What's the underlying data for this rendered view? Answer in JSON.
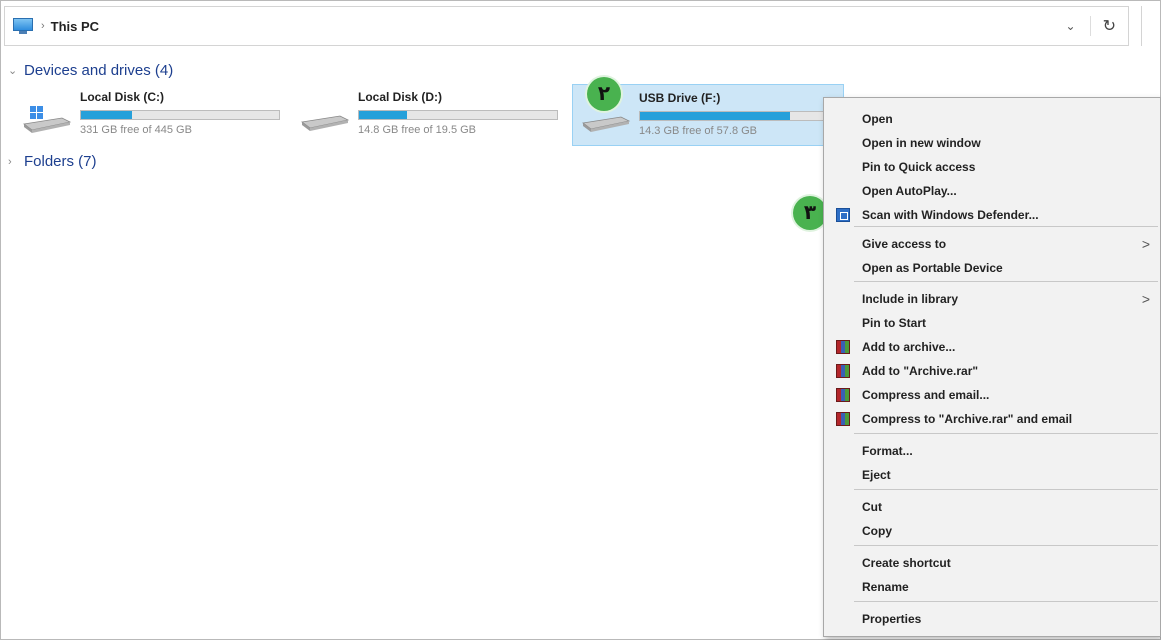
{
  "address": {
    "location": "This PC",
    "separator": "›",
    "dropdown": "⌄",
    "refresh": "↻"
  },
  "groups": {
    "devices": {
      "label": "Devices and drives (4)",
      "expanded": true
    },
    "folders": {
      "label": "Folders (7)",
      "expanded": false
    }
  },
  "drives": [
    {
      "name": "Local Disk (C:)",
      "free": "331 GB free of 445 GB",
      "used_fraction": 0.26,
      "icon": "windows-drive-icon"
    },
    {
      "name": "Local Disk (D:)",
      "free": "14.8 GB free of 19.5 GB",
      "used_fraction": 0.24,
      "icon": "hard-drive-icon"
    },
    {
      "name": "USB Drive (F:)",
      "free": "14.3 GB free of 57.8 GB",
      "used_fraction": 0.76,
      "icon": "usb-drive-icon",
      "selected": true
    }
  ],
  "badges": {
    "step2": "۲",
    "step3": "۳"
  },
  "context_menu": {
    "items": [
      {
        "label": "Open"
      },
      {
        "label": "Open in new window"
      },
      {
        "label": "Pin to Quick access"
      },
      {
        "label": "Open AutoPlay..."
      },
      {
        "label": "Scan with Windows Defender...",
        "icon": "windows-defender-icon"
      },
      {
        "label": "Give access to",
        "submenu": true
      },
      {
        "label": "Open as Portable Device"
      },
      {
        "label": "Include in library",
        "submenu": true
      },
      {
        "label": "Pin to Start"
      },
      {
        "label": "Add to archive...",
        "icon": "winrar-icon"
      },
      {
        "label": "Add to \"Archive.rar\"",
        "icon": "winrar-icon"
      },
      {
        "label": "Compress and email...",
        "icon": "winrar-icon"
      },
      {
        "label": "Compress to \"Archive.rar\" and email",
        "icon": "winrar-icon"
      },
      {
        "label": "Format..."
      },
      {
        "label": "Eject"
      },
      {
        "label": "Cut"
      },
      {
        "label": "Copy"
      },
      {
        "label": "Create shortcut"
      },
      {
        "label": "Rename"
      },
      {
        "label": "Properties"
      }
    ],
    "submenu_arrow": ">"
  },
  "colors": {
    "accent": "#26a0da",
    "selection": "#cde6f7",
    "badge": "#49b24f",
    "group_header": "#1d3f8f"
  }
}
